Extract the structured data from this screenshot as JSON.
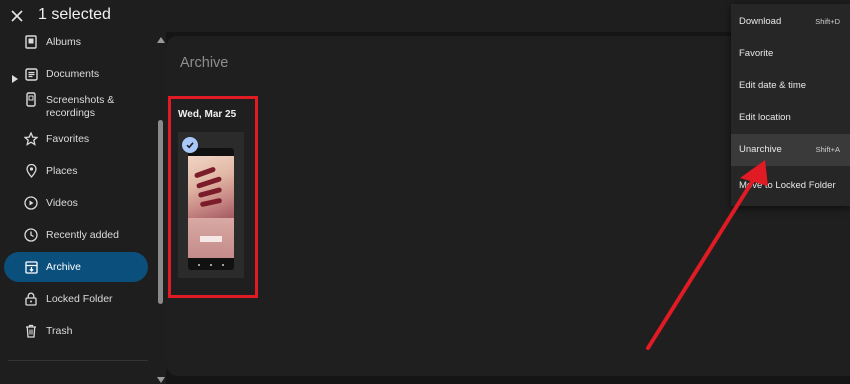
{
  "header": {
    "selection_title": "1 selected",
    "close_icon": "close-icon"
  },
  "sidebar": {
    "items": [
      {
        "label": "Albums",
        "icon": "albums-icon"
      },
      {
        "label": "Documents",
        "icon": "documents-icon"
      },
      {
        "label": "Screenshots &\nrecordings",
        "icon": "screenshots-icon"
      },
      {
        "label": "Favorites",
        "icon": "star-icon"
      },
      {
        "label": "Places",
        "icon": "location-pin-icon"
      },
      {
        "label": "Videos",
        "icon": "play-icon"
      },
      {
        "label": "Recently added",
        "icon": "history-icon"
      },
      {
        "label": "Archive",
        "icon": "archive-icon",
        "active": true
      },
      {
        "label": "Locked Folder",
        "icon": "lock-icon"
      },
      {
        "label": "Trash",
        "icon": "trash-icon"
      }
    ]
  },
  "main": {
    "title": "Archive",
    "date_group": "Wed, Mar 25"
  },
  "menu": {
    "items": [
      {
        "label": "Download",
        "shortcut": "Shift+D"
      },
      {
        "label": "Favorite",
        "shortcut": ""
      },
      {
        "label": "Edit date & time",
        "shortcut": ""
      },
      {
        "label": "Edit location",
        "shortcut": ""
      },
      {
        "label": "Unarchive",
        "shortcut": "Shift+A",
        "highlighted": true
      },
      {
        "label": "Move to Locked Folder",
        "shortcut": ""
      }
    ]
  },
  "colors": {
    "accent_active": "#0b4f7d",
    "annotation_red": "#e01b24",
    "selection_check": "#a8c7fa"
  }
}
